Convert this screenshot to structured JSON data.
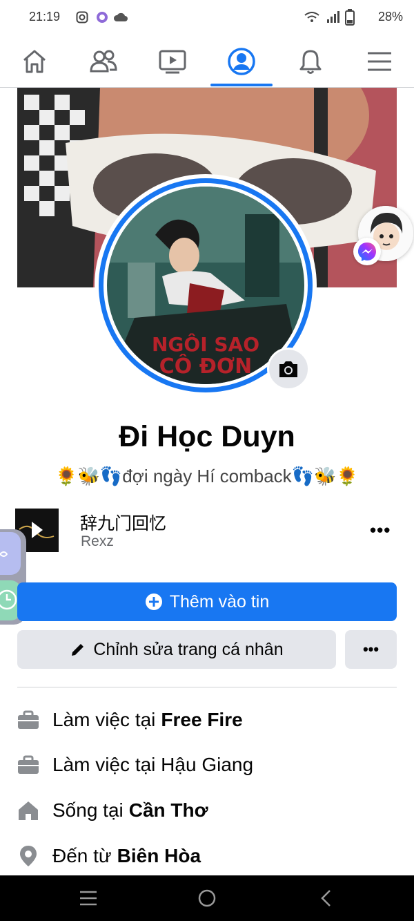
{
  "status_bar": {
    "time": "21:19",
    "battery": "28%"
  },
  "nav": {
    "tabs": [
      {
        "icon": "home-icon"
      },
      {
        "icon": "friends-icon"
      },
      {
        "icon": "watch-icon"
      },
      {
        "icon": "profile-icon",
        "active": true
      },
      {
        "icon": "bell-icon"
      },
      {
        "icon": "menu-icon"
      }
    ],
    "accent": "#1877f2"
  },
  "cover": {
    "description": "cover photo"
  },
  "profile_pic": {
    "overlay_text_1": "NGÔI SAO",
    "overlay_text_2": "CÔ ĐƠN"
  },
  "profile": {
    "name": "Đi Học Duyn",
    "bio": "🌻🐝👣đợi ngày Hí comback👣🐝🌻"
  },
  "music": {
    "title": "辞九门回忆",
    "artist": "Rexz",
    "more": "•••"
  },
  "buttons": {
    "add_story": "Thêm vào tin",
    "edit_profile": "Chỉnh sửa trang cá nhân",
    "more": "•••"
  },
  "details": [
    {
      "icon": "briefcase-icon",
      "prefix": "Làm việc tại",
      "bold": "Free Fire"
    },
    {
      "icon": "briefcase-icon",
      "prefix": "Làm việc tại Hậu Giang",
      "bold": ""
    },
    {
      "icon": "house-icon",
      "prefix": "Sống tại",
      "bold": "Cần Thơ"
    },
    {
      "icon": "location-pin-icon",
      "prefix": "Đến từ",
      "bold": "Biên Hòa"
    }
  ],
  "colors": {
    "primary": "#1877f2",
    "button_gray": "#e4e6eb",
    "secondary_text": "#65676b"
  }
}
